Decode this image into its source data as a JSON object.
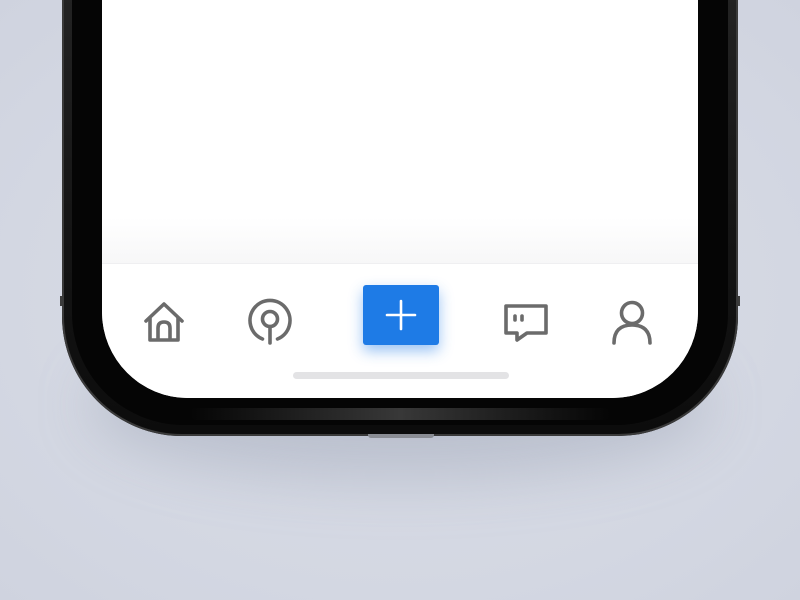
{
  "device": {
    "type": "smartphone",
    "frame_color": "#111111",
    "background_color": "#d7dbe6"
  },
  "tabbar": {
    "accent_color": "#1e7be6",
    "icon_color": "#6b6b6b",
    "items": [
      {
        "id": "home",
        "icon": "home-icon"
      },
      {
        "id": "discover",
        "icon": "location-pin-icon"
      },
      {
        "id": "add",
        "icon": "plus-icon",
        "style": "primary"
      },
      {
        "id": "messages",
        "icon": "chat-bubble-icon"
      },
      {
        "id": "profile",
        "icon": "user-icon"
      }
    ]
  }
}
